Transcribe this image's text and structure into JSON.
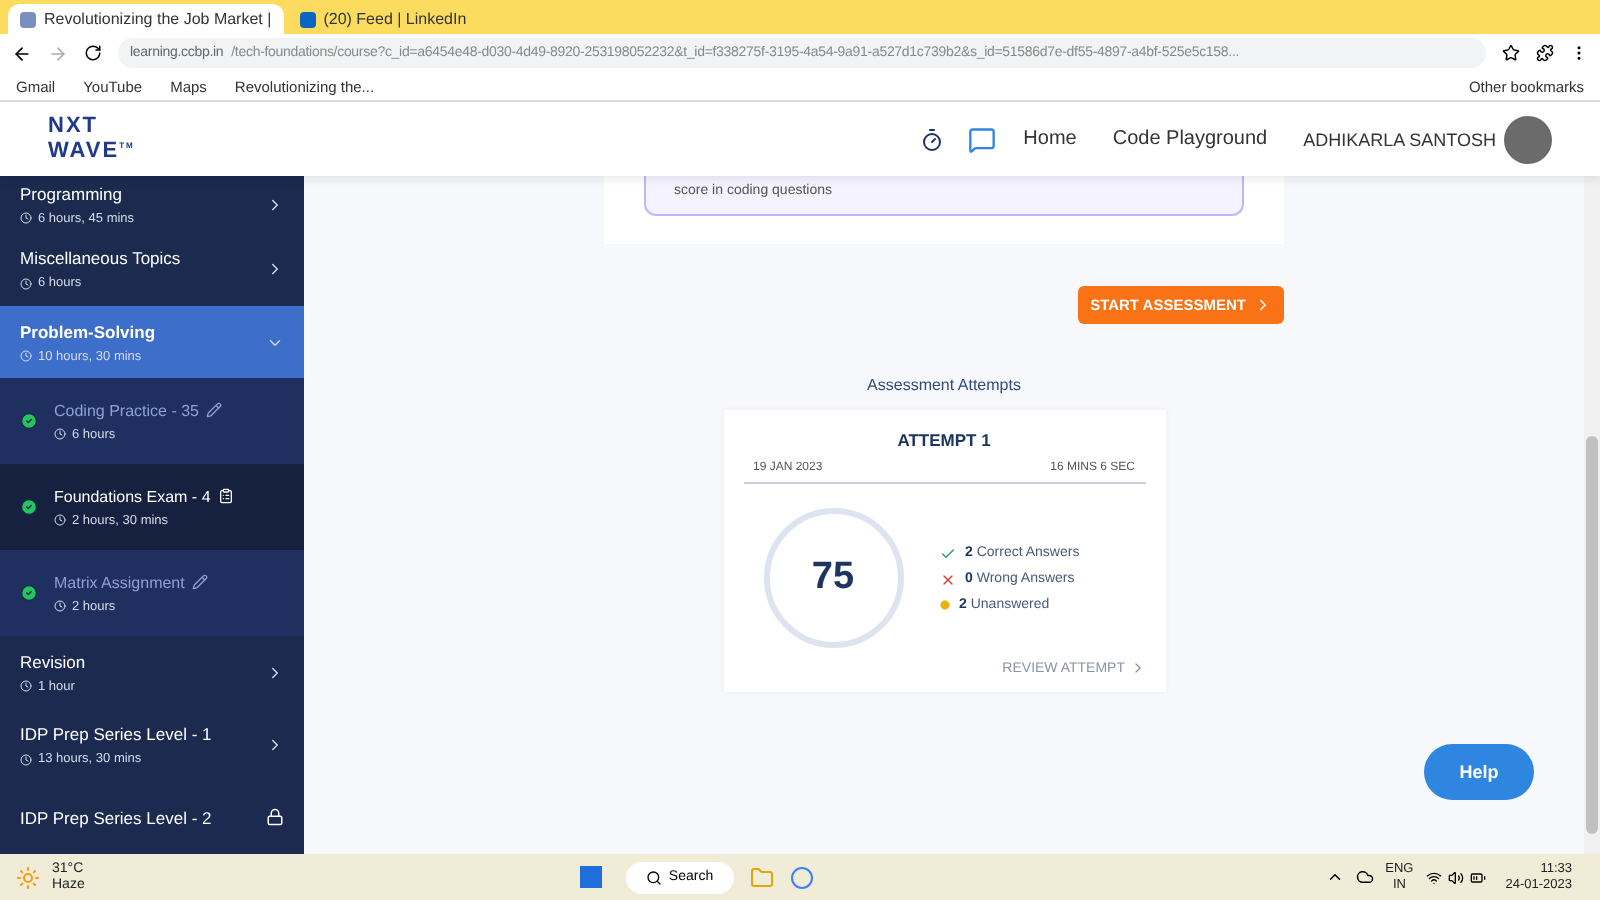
{
  "browser": {
    "tabs": [
      {
        "label": "Revolutionizing the Job Market |",
        "selected": true
      },
      {
        "label": "(20) Feed | LinkedIn",
        "selected": false
      }
    ],
    "address": {
      "host": "learning.ccbp.in",
      "path": "/tech-foundations/course?c_id=a6454e48-d030-4d49-8920-253198052232&t_id=f338275f-3195-4a54-9a91-a527d1c739b2&s_id=51586d7e-df55-4897-a4bf-525e5c158..."
    },
    "bookmarks": [
      "Gmail",
      "YouTube",
      "Maps",
      "Revolutionizing the..."
    ],
    "other_bookmarks": "Other bookmarks"
  },
  "header": {
    "logo_top": "NXT",
    "logo_bottom": "WAVE",
    "logo_mark": "TM",
    "nav": [
      "Home",
      "Code Playground"
    ],
    "user": "ADHIKARLA SANTOSH"
  },
  "sidebar": [
    {
      "title": "Programming",
      "duration": "6 hours, 45 mins",
      "expanded": false,
      "locked": false
    },
    {
      "title": "Miscellaneous Topics",
      "duration": "6 hours",
      "expanded": false,
      "locked": false
    },
    {
      "title": "Problem-Solving",
      "duration": "10 hours, 30 mins",
      "expanded": true,
      "locked": false,
      "children": [
        {
          "title": "Coding Practice - 35",
          "duration": "6 hours",
          "selected": false,
          "kind": "practice"
        },
        {
          "title": "Foundations Exam - 4",
          "duration": "2 hours, 30 mins",
          "selected": true,
          "kind": "exam"
        },
        {
          "title": "Matrix Assignment",
          "duration": "2 hours",
          "selected": false,
          "kind": "practice"
        }
      ]
    },
    {
      "title": "Revision",
      "duration": "1 hour",
      "expanded": false,
      "locked": false
    },
    {
      "title": "IDP Prep Series Level - 1",
      "duration": "13 hours, 30 mins",
      "expanded": false,
      "locked": false
    },
    {
      "title": "IDP Prep Series Level - 2",
      "expanded": false,
      "locked": true
    }
  ],
  "info_note": "score in coding questions",
  "start_button": "START ASSESSMENT",
  "attempts_title": "Assessment Attempts",
  "attempt": {
    "title": "ATTEMPT 1",
    "date": "19 JAN 2023",
    "time": "16 MINS 6 SEC",
    "score": "75",
    "results": [
      {
        "kind": "correct",
        "count": "2",
        "label": "Correct Answers"
      },
      {
        "kind": "wrong",
        "count": "0",
        "label": "Wrong Answers"
      },
      {
        "kind": "unanswered",
        "count": "2",
        "label": "Unanswered"
      }
    ],
    "review": "REVIEW ATTEMPT"
  },
  "help": "Help",
  "taskbar": {
    "temp": "31°C",
    "weather": "Haze",
    "search": "Search",
    "lang": "ENG",
    "region": "IN",
    "time": "11:33",
    "date": "24-01-2023"
  }
}
